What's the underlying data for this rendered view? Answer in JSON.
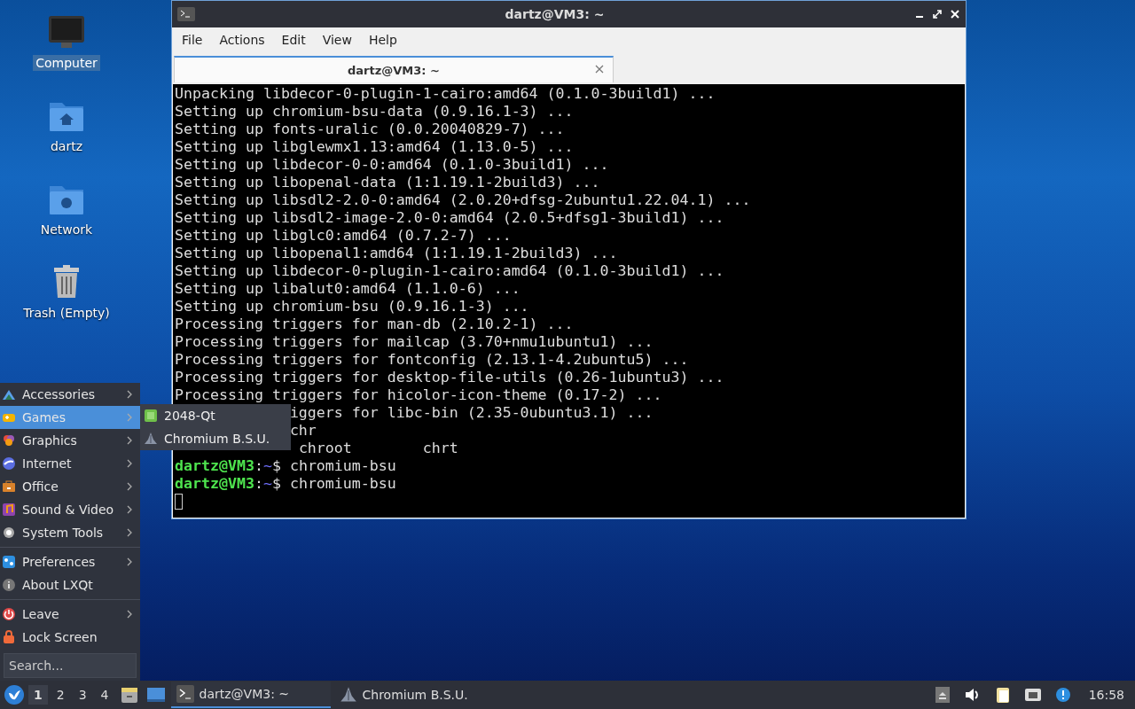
{
  "desktop_icons": [
    {
      "label": "Computer",
      "selected": true
    },
    {
      "label": "dartz",
      "selected": false
    },
    {
      "label": "Network",
      "selected": false
    },
    {
      "label": "Trash (Empty)",
      "selected": false
    }
  ],
  "window": {
    "title": "dartz@VM3: ~",
    "menu": [
      "File",
      "Actions",
      "Edit",
      "View",
      "Help"
    ],
    "tabs": [
      {
        "label": "dartz@VM3: ~",
        "selected": true
      }
    ],
    "terminal": {
      "lines": [
        {
          "kind": "text",
          "text": "Unpacking libdecor-0-plugin-1-cairo:amd64 (0.1.0-3build1) ..."
        },
        {
          "kind": "text",
          "text": "Setting up chromium-bsu-data (0.9.16.1-3) ..."
        },
        {
          "kind": "text",
          "text": "Setting up fonts-uralic (0.0.20040829-7) ..."
        },
        {
          "kind": "text",
          "text": "Setting up libglewmx1.13:amd64 (1.13.0-5) ..."
        },
        {
          "kind": "text",
          "text": "Setting up libdecor-0-0:amd64 (0.1.0-3build1) ..."
        },
        {
          "kind": "text",
          "text": "Setting up libopenal-data (1:1.19.1-2build3) ..."
        },
        {
          "kind": "text",
          "text": "Setting up libsdl2-2.0-0:amd64 (2.0.20+dfsg-2ubuntu1.22.04.1) ..."
        },
        {
          "kind": "text",
          "text": "Setting up libsdl2-image-2.0-0:amd64 (2.0.5+dfsg1-3build1) ..."
        },
        {
          "kind": "text",
          "text": "Setting up libglc0:amd64 (0.7.2-7) ..."
        },
        {
          "kind": "text",
          "text": "Setting up libopenal1:amd64 (1:1.19.1-2build3) ..."
        },
        {
          "kind": "text",
          "text": "Setting up libdecor-0-plugin-1-cairo:amd64 (0.1.0-3build1) ..."
        },
        {
          "kind": "text",
          "text": "Setting up libalut0:amd64 (1.1.0-6) ..."
        },
        {
          "kind": "text",
          "text": "Setting up chromium-bsu (0.9.16.1-3) ..."
        },
        {
          "kind": "text",
          "text": "Processing triggers for man-db (2.10.2-1) ..."
        },
        {
          "kind": "text",
          "text": "Processing triggers for mailcap (3.70+nmu1ubuntu1) ..."
        },
        {
          "kind": "text",
          "text": "Processing triggers for fontconfig (2.13.1-4.2ubuntu5) ..."
        },
        {
          "kind": "text",
          "text": "Processing triggers for desktop-file-utils (0.26-1ubuntu3) ..."
        },
        {
          "kind": "text",
          "text": "Processing triggers for hicolor-icon-theme (0.17-2) ..."
        },
        {
          "kind": "text",
          "text": "             iggers for libc-bin (2.35-0ubuntu3.1) ..."
        },
        {
          "kind": "text",
          "text": "             chr"
        },
        {
          "kind": "text",
          "text": "              chroot        chrt"
        },
        {
          "kind": "prompt",
          "user": "dartz@VM3",
          "sep": ":",
          "path": "~",
          "symbol": "$",
          "command": "chromium-bsu"
        },
        {
          "kind": "prompt",
          "user": "dartz@VM3",
          "sep": ":",
          "path": "~",
          "symbol": "$",
          "command": "chromium-bsu"
        },
        {
          "kind": "cursor"
        }
      ]
    }
  },
  "app_menu": {
    "items": [
      {
        "label": "Accessories",
        "submenu": true,
        "selected": false
      },
      {
        "label": "Games",
        "submenu": true,
        "selected": true
      },
      {
        "label": "Graphics",
        "submenu": true,
        "selected": false
      },
      {
        "label": "Internet",
        "submenu": true,
        "selected": false
      },
      {
        "label": "Office",
        "submenu": true,
        "selected": false
      },
      {
        "label": "Sound & Video",
        "submenu": true,
        "selected": false
      },
      {
        "label": "System Tools",
        "submenu": true,
        "selected": false
      },
      {
        "kind": "separator"
      },
      {
        "label": "Preferences",
        "submenu": true,
        "selected": false
      },
      {
        "label": "About LXQt",
        "submenu": false,
        "selected": false
      },
      {
        "kind": "separator"
      },
      {
        "label": "Leave",
        "submenu": true,
        "selected": false
      },
      {
        "label": "Lock Screen",
        "submenu": false,
        "selected": false
      }
    ],
    "search": {
      "placeholder": "Search..."
    },
    "submenu": [
      {
        "label": "2048-Qt"
      },
      {
        "label": "Chromium B.S.U."
      }
    ]
  },
  "taskbar": {
    "desktops": [
      {
        "label": "1",
        "selected": true
      },
      {
        "label": "2",
        "selected": false
      },
      {
        "label": "3",
        "selected": false
      },
      {
        "label": "4",
        "selected": false
      }
    ],
    "tasks": [
      {
        "label": "dartz@VM3: ~",
        "selected": true
      },
      {
        "label": "Chromium B.S.U.",
        "selected": false
      }
    ],
    "clock": "16:58"
  }
}
